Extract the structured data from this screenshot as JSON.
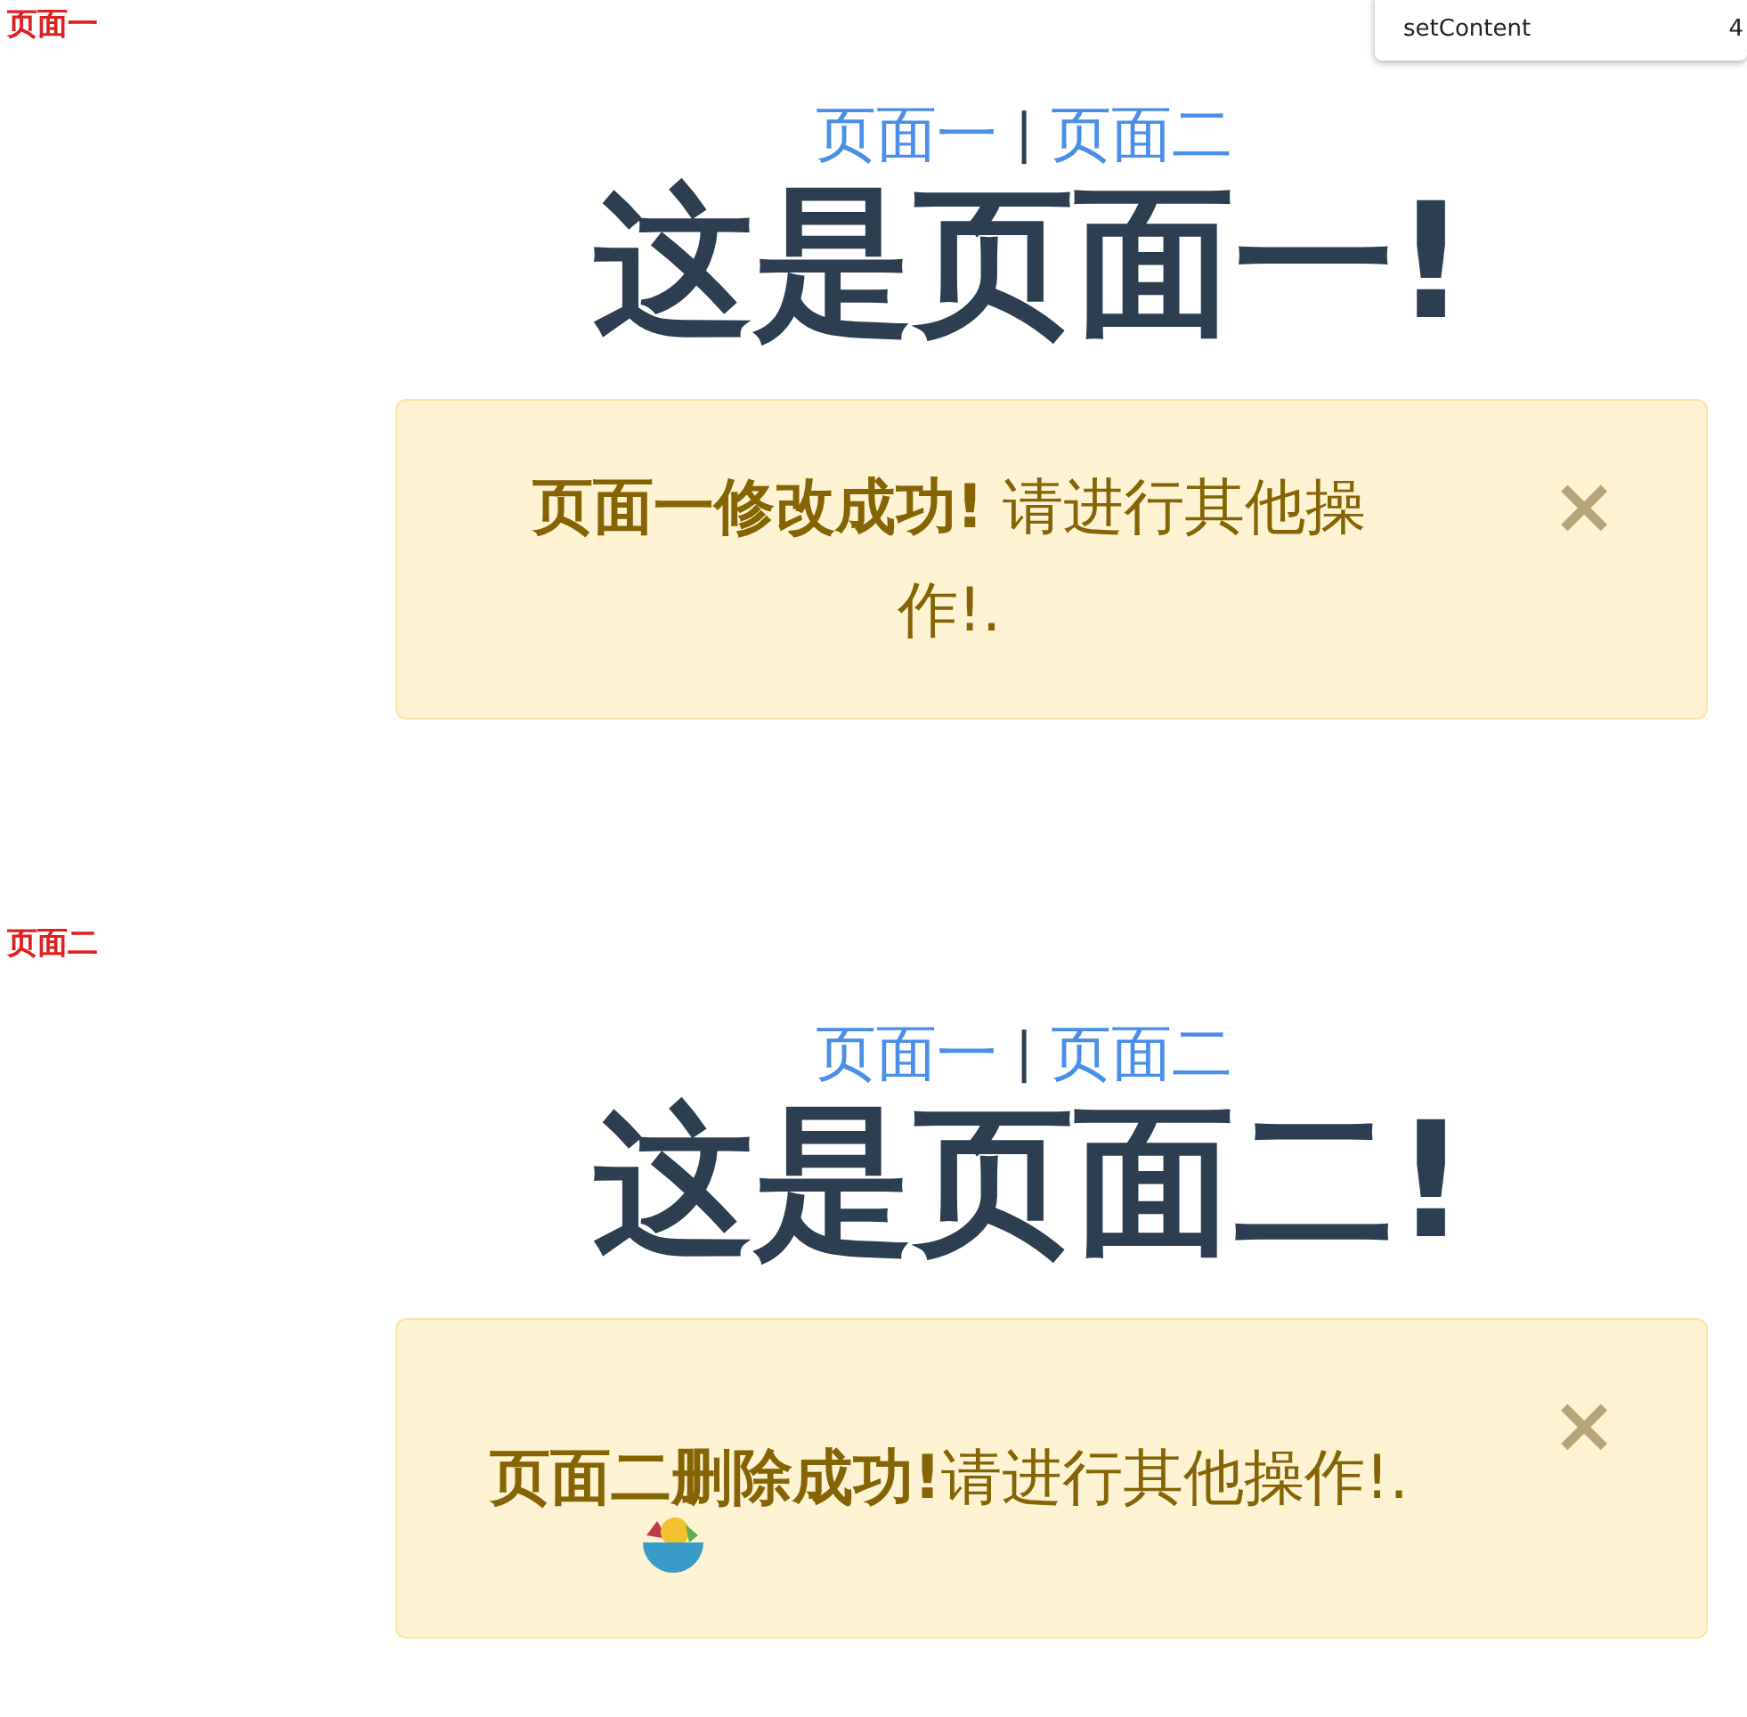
{
  "popup": {
    "label": "setContent",
    "value": "4"
  },
  "pages": [
    {
      "label": "页面一",
      "nav": [
        {
          "text": "页面一"
        },
        {
          "text": "页面二"
        }
      ],
      "separator": "|",
      "heading": "这是页面一!",
      "alert": {
        "message": "**页面一修改成功!** 请进行其他操作!.",
        "close": "×"
      }
    },
    {
      "label": "页面二",
      "nav": [
        {
          "text": "页面一"
        },
        {
          "text": "页面二"
        }
      ],
      "separator": "|",
      "heading": "这是页面二!",
      "alert": {
        "message": "**页面二删除成功!**请进行其他操作!.",
        "close": "×"
      }
    }
  ]
}
